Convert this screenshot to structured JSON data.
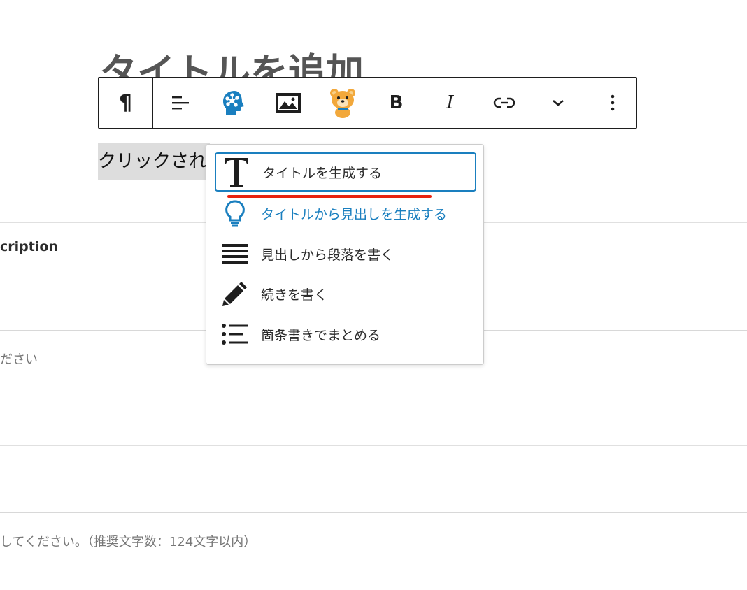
{
  "editor": {
    "title_placeholder": "タイトルを追加",
    "paragraph_text": "クリックされ"
  },
  "toolbar": {
    "buttons": [
      {
        "name": "paragraph",
        "glyph": "¶"
      },
      {
        "name": "align"
      },
      {
        "name": "ai-brain"
      },
      {
        "name": "image"
      },
      {
        "name": "bear-mascot"
      },
      {
        "name": "bold",
        "glyph": "B"
      },
      {
        "name": "italic",
        "glyph": "I"
      },
      {
        "name": "link"
      },
      {
        "name": "more",
        "glyph": "⌄"
      },
      {
        "name": "options",
        "glyph": "⋮"
      }
    ]
  },
  "menu": {
    "items": [
      {
        "label": "タイトルを生成する",
        "icon": "title-T-icon"
      },
      {
        "label": "タイトルから見出しを生成する",
        "icon": "lightbulb-icon"
      },
      {
        "label": "見出しから段落を書く",
        "icon": "lines-icon"
      },
      {
        "label": "続きを書く",
        "icon": "pencil-icon"
      },
      {
        "label": "箇条書きでまとめる",
        "icon": "list-icon"
      }
    ]
  },
  "fields": {
    "description_label": "cription",
    "placeholder_1": "ださい",
    "placeholder_2": "してください。（推奨文字数：124文字以内）"
  },
  "colors": {
    "accent_blue": "#1a7fbf",
    "underline_red": "#e8220f",
    "bear_orange": "#f2a83b",
    "highlight_gray": "#dddddd"
  }
}
